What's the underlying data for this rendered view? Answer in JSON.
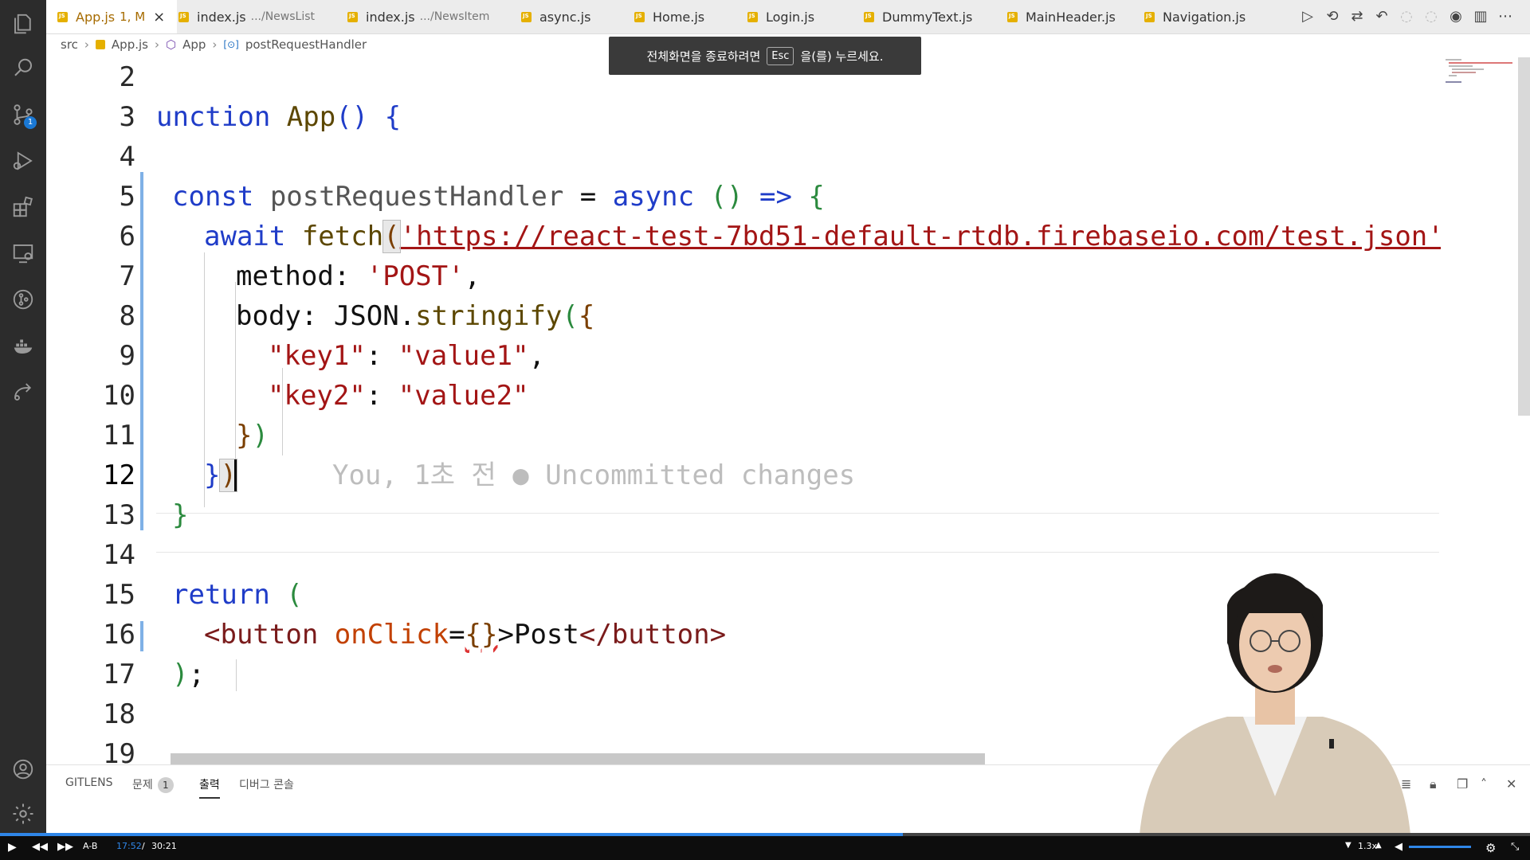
{
  "tabs": [
    {
      "label": "App.js",
      "modified": "1, M",
      "active": true
    },
    {
      "label": "index.js",
      "path": ".../NewsList"
    },
    {
      "label": "index.js",
      "path": ".../NewsItem"
    },
    {
      "label": "async.js"
    },
    {
      "label": "Home.js"
    },
    {
      "label": "Login.js"
    },
    {
      "label": "DummyText.js"
    },
    {
      "label": "MainHeader.js"
    },
    {
      "label": "Navigation.js"
    }
  ],
  "breadcrumb": [
    "src",
    "App.js",
    "App",
    "postRequestHandler"
  ],
  "toast": {
    "before": "전체화면을 종료하려면",
    "key": "Esc",
    "after": "을(를) 누르세요."
  },
  "activity": {
    "scm_badge": "1"
  },
  "editor": {
    "line_numbers": [
      "2",
      "3",
      "4",
      "5",
      "6",
      "7",
      "8",
      "9",
      "10",
      "11",
      "12",
      "13",
      "14",
      "15",
      "16",
      "17",
      "18",
      "19"
    ],
    "lines": {
      "l3": {
        "a": "unction ",
        "b": "App",
        "c": "()",
        "d": " {"
      },
      "l5": {
        "a": "const",
        "b": " postRequestHandler",
        "c": " = ",
        "d": "async",
        "e": " ()",
        "f": " => ",
        "g": "{"
      },
      "l6": {
        "a": "await",
        "b": " fetch",
        "c": "(",
        "d": "'https://react-test-7bd51-default-rtdb.firebaseio.com/test.json'",
        "e": ","
      },
      "l7": {
        "a": "method: ",
        "b": "'POST'",
        "c": ","
      },
      "l8": {
        "a": "body: JSON.",
        "b": "stringify",
        "c": "(",
        "d": "{"
      },
      "l9": {
        "a": "\"key1\"",
        "b": ": ",
        "c": "\"value1\"",
        "d": ","
      },
      "l10": {
        "a": "\"key2\"",
        "b": ": ",
        "c": "\"value2\""
      },
      "l11": {
        "a": "}",
        "b": ")"
      },
      "l12": {
        "a": "}",
        "b": ")",
        "blame": "You, 1초 전 ● Uncommitted changes"
      },
      "l13": {
        "a": "}"
      },
      "l15": {
        "a": "return",
        "b": " ("
      },
      "l16": {
        "a": "<button",
        "b": " onClick",
        "c": "=",
        "d": "{}",
        "e": ">Post",
        "f": "</button>"
      },
      "l17": {
        "a": ")",
        "b": ";"
      }
    }
  },
  "panel": {
    "tabs": [
      "GITLENS",
      "문제",
      "출력",
      "디버그 콘솔"
    ],
    "problems_count": "1"
  },
  "player": {
    "ab": "A-B",
    "current": "17:52",
    "sep": "/",
    "total": "30:21",
    "speed": "1.3x",
    "progress": 0.59
  }
}
